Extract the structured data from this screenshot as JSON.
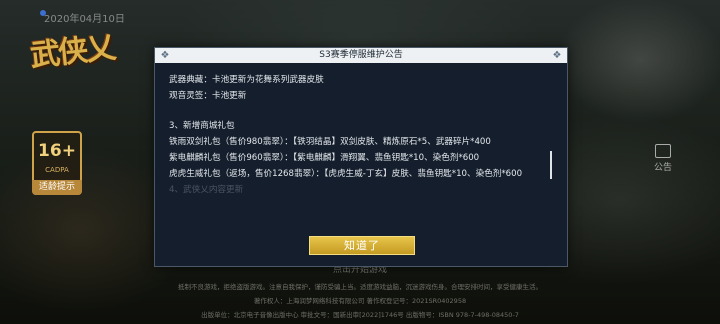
{
  "top_status": "2020年04月10日",
  "game_logo_text": "武侠乂",
  "age_rating": {
    "age": "16+",
    "org": "CADPA",
    "tip_label": "适龄提示"
  },
  "side_button": {
    "label": "公告"
  },
  "start_hint": "点击开始游戏",
  "bottom_lines": [
    "抵制不良游戏，拒绝盗版游戏。注意自我保护，谨防受骗上当。适度游戏益脑，沉迷游戏伤身。合理安排时间，享受健康生活。",
    "著作权人：上海润梦网络科技有限公司    著作权登记号：2021SR0402958",
    "出版单位：北京电子音像出版中心    审批文号：国新出审[2022]1746号    出版物号：ISBN 978-7-498-08450-7"
  ],
  "dialog": {
    "title": "S3赛季停服维护公告",
    "lines": [
      "武器典藏：卡池更新为花舞系列武器皮肤",
      "观音灵签：卡池更新",
      "",
      "3、新增商城礼包",
      "铁雨双剑礼包（售价980翡翠）：【铁羽结晶】双剑皮肤、精炼原石*5、武器碎片*400",
      "紫电麒麟礼包（售价960翡翠）：【紫电麒麟】滑翔翼、翡鱼钥匙*10、染色剂*600",
      "虎虎生威礼包（返场，售价1268翡翠）：【虎虎生威-丁玄】皮肤、翡鱼钥匙*10、染色剂*600",
      "4、武侠乂内容更新"
    ],
    "ok_label": "知道了"
  }
}
